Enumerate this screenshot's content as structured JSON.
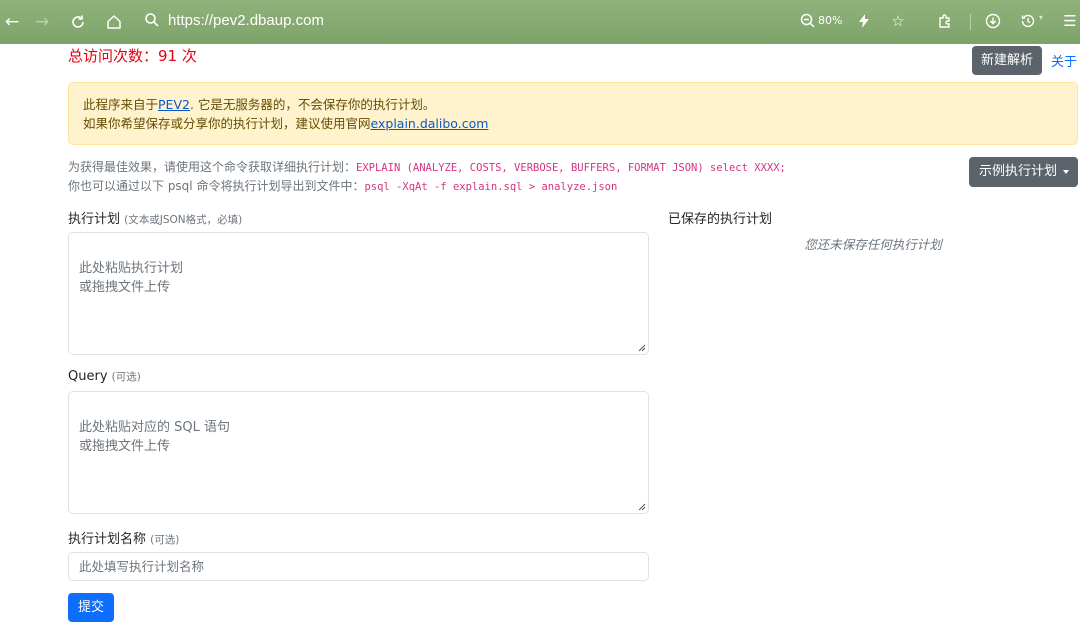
{
  "browser": {
    "url": "https://pev2.dbaup.com",
    "zoom": "80%"
  },
  "header": {
    "visit_count": "总访问次数：91 次",
    "new_button": "新建解析",
    "about_link": "关于"
  },
  "alert": {
    "line1_prefix": "此程序来自于",
    "line1_link": "PEV2",
    "line1_suffix": ". 它是无服务器的，不会保存你的执行计划。",
    "line2_prefix": "如果你希望保存或分享你的执行计划，建议使用官网",
    "line2_link": "explain.dalibo.com"
  },
  "hint": {
    "line1_text": "为获得最佳效果，请使用这个命令获取详细执行计划：",
    "line1_code": "EXPLAIN (ANALYZE, COSTS, VERBOSE, BUFFERS, FORMAT JSON) select XXXX;",
    "line2_text": "你也可以通过以下 psql 命令将执行计划导出到文件中：",
    "line2_code": "psql -XqAt -f explain.sql > analyze.json"
  },
  "sample_button": "示例执行计划",
  "plan_field": {
    "label": "执行计划",
    "hint": "(文本或JSON格式，必填)",
    "placeholder": "此处粘贴执行计划\n或拖拽文件上传"
  },
  "query_field": {
    "label": "Query",
    "hint": "(可选)",
    "placeholder": "此处粘贴对应的 SQL 语句\n或拖拽文件上传"
  },
  "name_field": {
    "label": "执行计划名称",
    "hint": "(可选)",
    "placeholder": "此处填写执行计划名称"
  },
  "submit_button": "提交",
  "saved_plans": {
    "title": "已保存的执行计划",
    "empty_message": "您还未保存任何执行计划"
  }
}
